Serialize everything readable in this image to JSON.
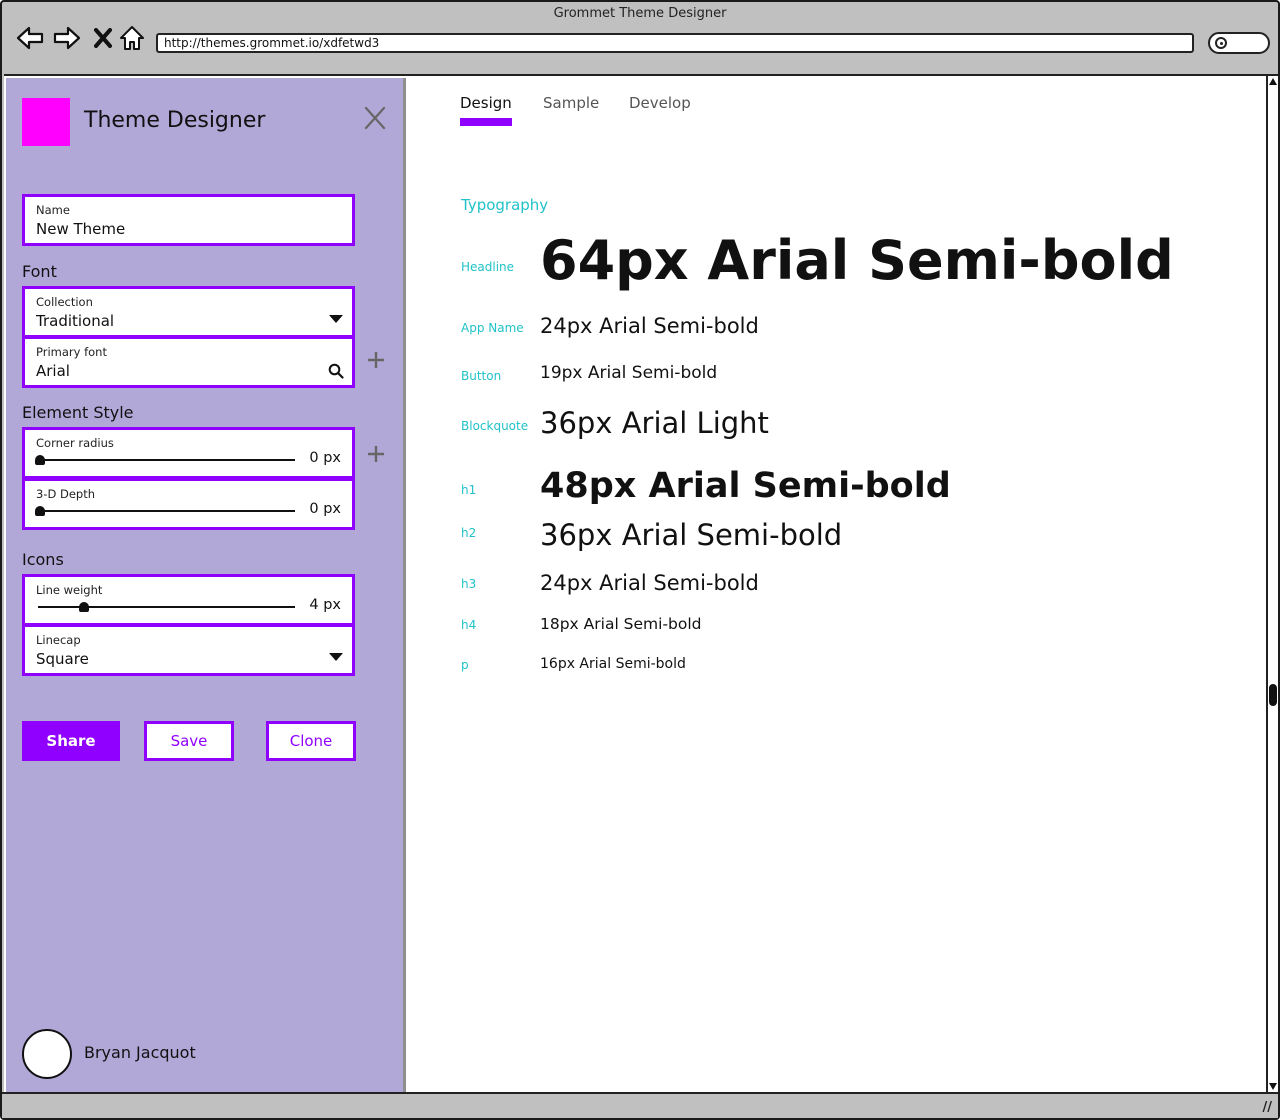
{
  "window": {
    "title": "Grommet Theme Designer",
    "url": "http://themes.grommet.io/xdfetwd3"
  },
  "colors": {
    "accent": "#9000ff",
    "brand_square": "#ff00ff",
    "sidebar_bg": "#b2a8d8",
    "label_teal": "#21c2c8"
  },
  "sidebar": {
    "title": "Theme Designer",
    "name_field": {
      "label": "Name",
      "value": "New Theme"
    },
    "font_section": "Font",
    "collection": {
      "label": "Collection",
      "value": "Traditional"
    },
    "primary_font": {
      "label": "Primary font",
      "value": "Arial"
    },
    "element_style_section": "Element Style",
    "corner_radius": {
      "label": "Corner radius",
      "value": "0 px",
      "level": 0
    },
    "depth": {
      "label": "3-D Depth",
      "value": "0 px",
      "level": 0
    },
    "icons_section": "Icons",
    "line_weight": {
      "label": "Line weight",
      "value": "4 px",
      "level": 0.17
    },
    "linecap": {
      "label": "Linecap",
      "value": "Square"
    },
    "buttons": {
      "share": "Share",
      "save": "Save",
      "clone": "Clone"
    },
    "user": {
      "name": "Bryan Jacquot"
    }
  },
  "tabs": [
    {
      "label": "Design",
      "active": true
    },
    {
      "label": "Sample",
      "active": false
    },
    {
      "label": "Develop",
      "active": false
    }
  ],
  "typography": {
    "heading": "Typography",
    "rows": [
      {
        "label": "Headline",
        "sample": "64px Arial Semi-bold"
      },
      {
        "label": "App Name",
        "sample": "24px Arial Semi-bold"
      },
      {
        "label": "Button",
        "sample": "19px Arial Semi-bold"
      },
      {
        "label": "Blockquote",
        "sample": "36px Arial Light"
      },
      {
        "label": "h1",
        "sample": "48px Arial Semi-bold"
      },
      {
        "label": "h2",
        "sample": "36px Arial Semi-bold"
      },
      {
        "label": "h3",
        "sample": "24px Arial Semi-bold"
      },
      {
        "label": "h4",
        "sample": "18px Arial Semi-bold"
      },
      {
        "label": "p",
        "sample": "16px Arial Semi-bold"
      }
    ]
  }
}
